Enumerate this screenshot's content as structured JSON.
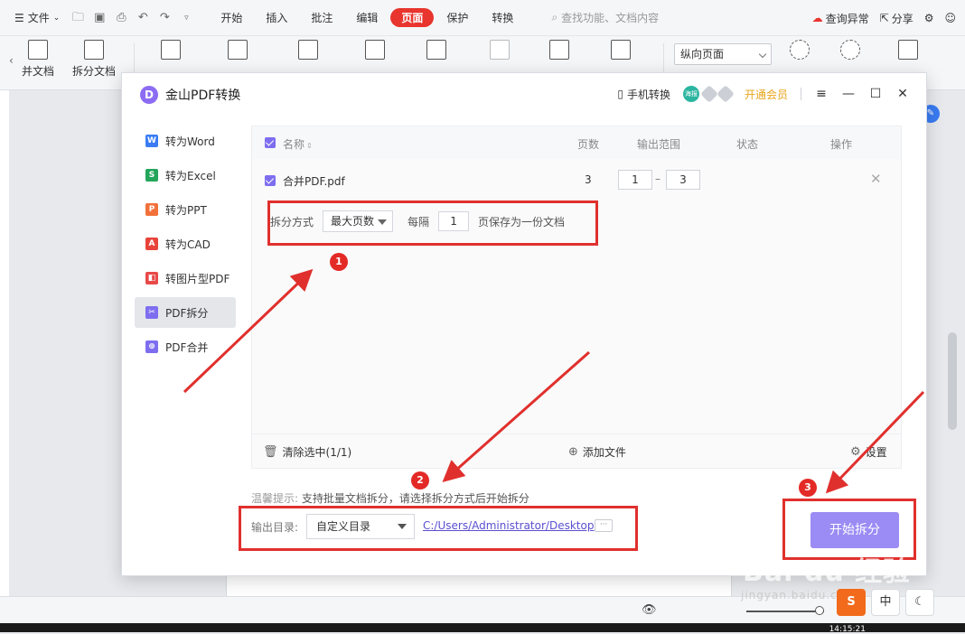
{
  "app": {
    "menu": {
      "file_label": "文件",
      "tabs": [
        {
          "label": "开始",
          "active": false
        },
        {
          "label": "插入",
          "active": false
        },
        {
          "label": "批注",
          "active": false
        },
        {
          "label": "编辑",
          "active": false
        },
        {
          "label": "页面",
          "active": true
        },
        {
          "label": "保护",
          "active": false
        },
        {
          "label": "转换",
          "active": false
        }
      ],
      "search_placeholder": "查找功能、文档内容",
      "query_error": "查询异常",
      "share": "分享"
    },
    "toolbar": {
      "merge_doc": "并文档",
      "split_doc": "拆分文档",
      "orientation": "纵向页面"
    },
    "clock": "14:15:21"
  },
  "dialog": {
    "title": "金山PDF转换",
    "logo_letter": "D",
    "mobile_convert": "手机转换",
    "vip_badge": "海报",
    "vip_link": "开通会员",
    "sidebar": [
      {
        "label": "转为Word",
        "icon": "word-icon",
        "color": "#3b7cf4",
        "letter": "W",
        "active": false
      },
      {
        "label": "转为Excel",
        "icon": "excel-icon",
        "color": "#23a55a",
        "letter": "S",
        "active": false
      },
      {
        "label": "转为PPT",
        "icon": "ppt-icon",
        "color": "#f2703a",
        "letter": "P",
        "active": false
      },
      {
        "label": "转为CAD",
        "icon": "cad-icon",
        "color": "#e8433a",
        "letter": "A",
        "active": false
      },
      {
        "label": "转图片型PDF",
        "icon": "image-pdf-icon",
        "color": "#e84a4a",
        "letter": "◧",
        "active": false
      },
      {
        "label": "PDF拆分",
        "icon": "pdf-split-icon",
        "color": "#7d6ef0",
        "letter": "✂",
        "active": true
      },
      {
        "label": "PDF合并",
        "icon": "pdf-merge-icon",
        "color": "#7d6ef0",
        "letter": "⊕",
        "active": false
      }
    ],
    "list": {
      "columns": {
        "name": "名称",
        "pages": "页数",
        "range": "输出范围",
        "status": "状态",
        "action": "操作"
      },
      "rows": [
        {
          "name": "合并PDF.pdf",
          "pages": "3",
          "range_from": "1",
          "range_to": "3",
          "range_sep": "–"
        }
      ],
      "split": {
        "method_label": "拆分方式",
        "method_value": "最大页数",
        "every_label": "每隔",
        "every_value": "1",
        "suffix": "页保存为一份文档"
      },
      "footer": {
        "clear_selected": "清除选中(1/1)",
        "add_file": "添加文件",
        "settings": "设置"
      }
    },
    "tip": {
      "label": "温馨提示:",
      "text": "支持批量文档拆分，请选择拆分方式后开始拆分"
    },
    "output": {
      "label": "输出目录:",
      "mode": "自定义目录",
      "path": "C:/Users/Administrator/Desktop",
      "more": "···"
    },
    "start_button": "开始拆分"
  },
  "annotations": {
    "labels": [
      "1",
      "2",
      "3"
    ],
    "color": "#e0302d"
  },
  "watermark": {
    "main": "Bai du 经验",
    "sub": "jingyan.baidu.com"
  },
  "float_tools": {
    "logo": "S",
    "lang": "中",
    "moon": "☾"
  }
}
